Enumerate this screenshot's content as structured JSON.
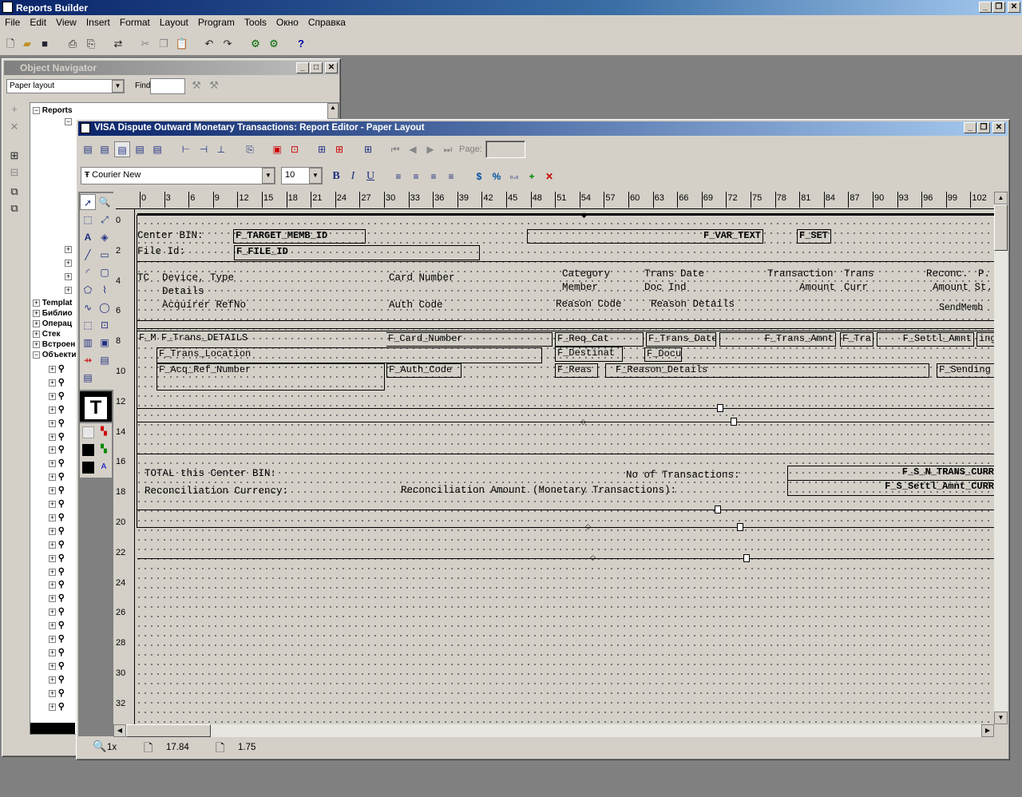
{
  "app": {
    "title": "Reports Builder"
  },
  "menu": [
    "File",
    "Edit",
    "View",
    "Insert",
    "Format",
    "Layout",
    "Program",
    "Tools",
    "Окно",
    "Справка"
  ],
  "toolbar_icons": [
    "new-icon",
    "open-icon",
    "save-icon",
    "print-icon",
    "print-setup-icon",
    "convert-icon",
    "cut-icon",
    "copy-icon",
    "paste-icon",
    "undo-icon",
    "redo-icon",
    "run-icon",
    "compile-icon",
    "help-icon"
  ],
  "navigator": {
    "title": "Object Navigator",
    "view_select": "Paper layout",
    "find_label": "Find:",
    "find_value": "",
    "tree": [
      "Reports",
      "Templat",
      "Библио",
      "Операц",
      "Стек",
      "Встроен",
      "Объекти"
    ]
  },
  "editor": {
    "title": "VISA Dispute Outward Monetary Transactions: Report Editor - Paper Layout",
    "page_label": "Page:",
    "page_value": "",
    "font": "Courier New",
    "font_size": "10",
    "bold": "B",
    "italic": "I",
    "underline": "U",
    "ruler_x": [
      "0",
      "3",
      "6",
      "9",
      "12",
      "15",
      "18",
      "21",
      "24",
      "27",
      "30",
      "33",
      "36",
      "39",
      "42",
      "45",
      "48",
      "51",
      "54",
      "57",
      "60",
      "63",
      "66",
      "69",
      "72",
      "75",
      "78",
      "81",
      "84",
      "87",
      "90",
      "93",
      "96",
      "99",
      "102"
    ],
    "ruler_y": [
      "0",
      "2",
      "4",
      "6",
      "8",
      "10",
      "12",
      "14",
      "16",
      "18",
      "20",
      "22",
      "24",
      "26",
      "28",
      "30",
      "32"
    ],
    "labels": {
      "center_bin": "Center BIN:",
      "file_id": "File Id:",
      "tc": "TC",
      "device_type": "Device, Type",
      "details": "Details",
      "acquirer_refno": "Acquirer RefNo",
      "card_number": "Card Number",
      "auth_code": "Auth Code",
      "category": "Category",
      "member": "Member",
      "reason_code": "Reason Code",
      "trans_date": "Trans Date",
      "doc_ind": "Doc Ind",
      "reason_details": "Reason Details",
      "transaction_amount": "Transaction",
      "amount": "Amount",
      "trans_curr_top": "Trans",
      "curr": "Curr",
      "reconc": "Reconc.",
      "amount_st": "Amount St.",
      "p_": "P.",
      "sendmemb": "SendMemb",
      "total_center_bin": "TOTAL this Center BIN:",
      "recon_currency": "Reconciliation Currency:",
      "no_of_trans": "No of Transactions:",
      "recon_amount": "Reconciliation Amount (Monetary Transactions):"
    },
    "fields": {
      "target_memb": "F_TARGET_MEMB_ID",
      "var_text": "F_VAR_TEXT",
      "set": "F_SET",
      "file_id": "F_FILE_ID",
      "f_m": "F_M",
      "trans_details": "F_Trans_DETAILS",
      "card_number": "F_Card_Number",
      "req_cat": "F_Req_Cat",
      "trans_date": "F_Trans_Date",
      "trans_amnt": "F_Trans_Amnt",
      "f_tra": "F_Tra",
      "settl_amnt": "F_Settl_Amnt",
      "ing": "ing",
      "trans_location": "F_Trans_Location",
      "destinat": "F_Destinat",
      "docu": "F_Docu",
      "acq_ref": "F_Acq_Ref_Number",
      "auth_code": "F_Auth_Code",
      "reas": "F_Reas",
      "reason_details": "F_Reason_Details",
      "sending": "F_Sending",
      "s_n_trans": "F_S_N_TRANS_CURR",
      "s_settl": "F_S_Settl_Amnt_CURR"
    },
    "status": {
      "zoom": "1x",
      "x": "17.84",
      "y": "1.75"
    }
  }
}
